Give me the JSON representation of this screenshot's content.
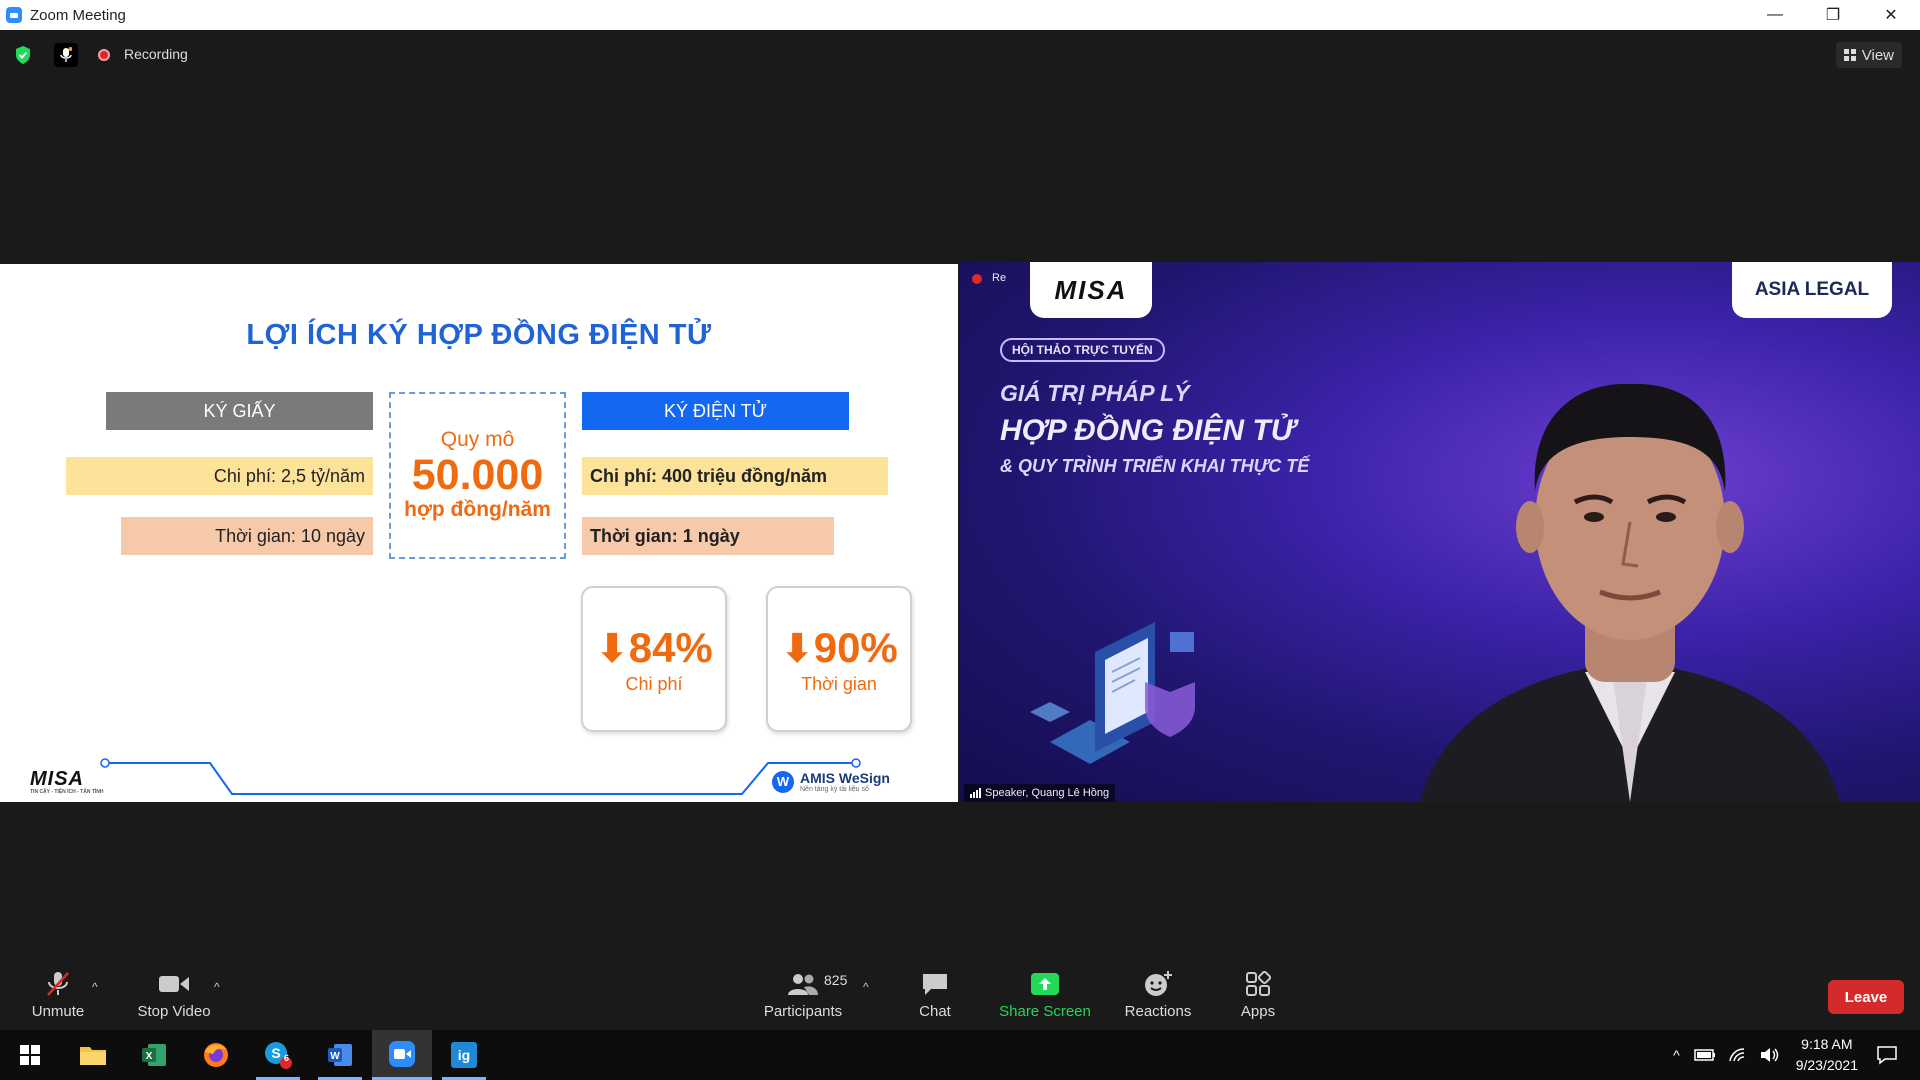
{
  "window": {
    "title": "Zoom Meeting"
  },
  "top_bar": {
    "recording_label": "Recording",
    "view_label": "View"
  },
  "slide": {
    "title": "LỢI ÍCH KÝ HỢP ĐỒNG ĐIỆN TỬ",
    "paper_header": "KÝ GIẤY",
    "digital_header": "KÝ ĐIỆN TỬ",
    "scale_label": "Quy mô",
    "scale_value": "50.000",
    "scale_unit": "hợp đồng/năm",
    "paper_cost": "Chi phí: 2,5 tỷ/năm",
    "paper_time": "Thời gian: 10 ngày",
    "digital_cost": "Chi phí: 400 triệu đồng/năm",
    "digital_time": "Thời gian: 1 ngày",
    "stats": [
      {
        "value": "84%",
        "label": "Chi phí"
      },
      {
        "value": "90%",
        "label": "Thời gian"
      }
    ],
    "footer_logo": "MISA",
    "footer_logo_sub": "TIN CẬY - TIỆN ÍCH - TẬN TÌNH",
    "footer_brand": "AMIS WeSign",
    "footer_brand_sub": "Nền tảng ký tài liệu số"
  },
  "video": {
    "rec_label": "Re",
    "misa_banner": "MISA",
    "asia_banner": "ASIA LEGAL",
    "pill": "HỘI THẢO TRỰC TUYẾN",
    "heading1": "GIÁ TRỊ PHÁP LÝ",
    "heading2": "HỢP ĐỒNG ĐIỆN TỬ",
    "heading3": "& QUY TRÌNH TRIỂN KHAI THỰC TẾ",
    "speaker_label": "Speaker, Quang Lê Hồng"
  },
  "toolbar": {
    "unmute": "Unmute",
    "stop_video": "Stop Video",
    "participants": "Participants",
    "participants_count": "825",
    "chat": "Chat",
    "share_screen": "Share Screen",
    "reactions": "Reactions",
    "apps": "Apps",
    "leave": "Leave"
  },
  "taskbar": {
    "skype_badge": "6",
    "time": "9:18 AM",
    "date": "9/23/2021"
  },
  "colors": {
    "accent": "#2d8cff",
    "share_green": "#23d959",
    "leave_red": "#d32b2b",
    "slide_orange": "#f06a0f",
    "slide_blue": "#1467f0"
  }
}
